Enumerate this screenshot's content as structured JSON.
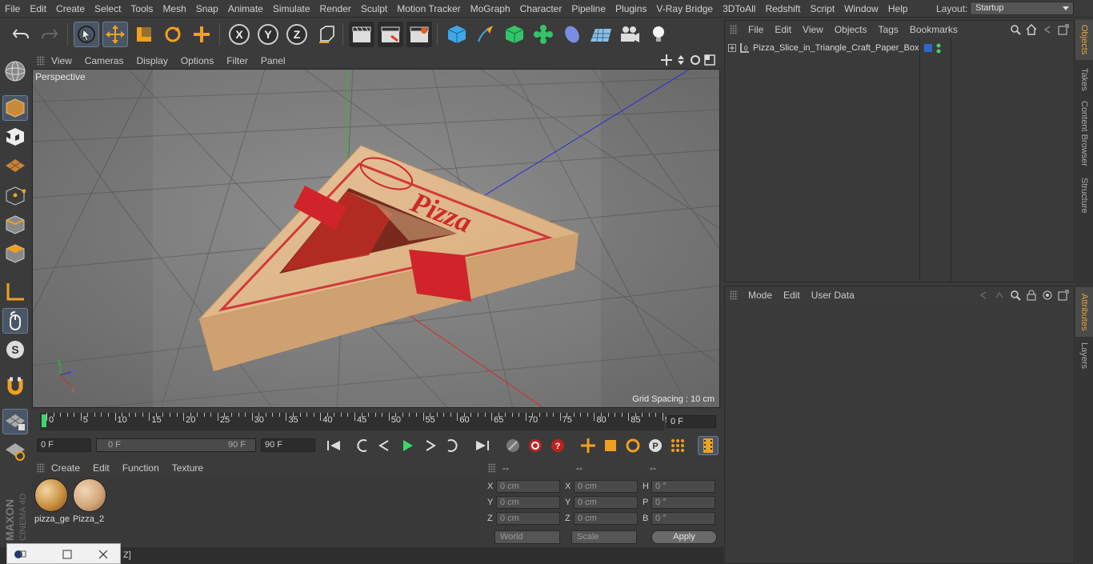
{
  "menubar": {
    "items": [
      "File",
      "Edit",
      "Create",
      "Select",
      "Tools",
      "Mesh",
      "Snap",
      "Animate",
      "Simulate",
      "Render",
      "Sculpt",
      "Motion Tracker",
      "MoGraph",
      "Character",
      "Pipeline",
      "Plugins",
      "V-Ray Bridge",
      "3DToAll",
      "Redshift",
      "Script",
      "Window",
      "Help"
    ],
    "layout_label": "Layout:",
    "layout_value": "Startup"
  },
  "toolbar": {
    "x_label": "X",
    "y_label": "Y",
    "z_label": "Z"
  },
  "viewport": {
    "menu": [
      "View",
      "Cameras",
      "Display",
      "Options",
      "Filter",
      "Panel"
    ],
    "label": "Perspective",
    "grid_spacing": "Grid Spacing : 10 cm",
    "box_text": "Pizza"
  },
  "timeline": {
    "ticks": [
      "0",
      "5",
      "10",
      "15",
      "20",
      "25",
      "30",
      "35",
      "40",
      "45",
      "50",
      "55",
      "60",
      "65",
      "70",
      "75",
      "80",
      "85",
      "90"
    ],
    "current_frame": "0 F"
  },
  "transport": {
    "start": "0 F",
    "range_start": "0 F",
    "range_end": "90 F",
    "end": "90 F"
  },
  "materials": {
    "menu": [
      "Create",
      "Edit",
      "Function",
      "Texture"
    ],
    "items": [
      {
        "name": "pizza_ge"
      },
      {
        "name": "Pizza_2"
      }
    ]
  },
  "coordinates": {
    "head": [
      "--",
      "--",
      "--"
    ],
    "rows": [
      {
        "l1": "X",
        "v1": "0 cm",
        "l2": "X",
        "v2": "0 cm",
        "l3": "H",
        "v3": "0 °"
      },
      {
        "l1": "Y",
        "v1": "0 cm",
        "l2": "Y",
        "v2": "0 cm",
        "l3": "P",
        "v3": "0 °"
      },
      {
        "l1": "Z",
        "v1": "0 cm",
        "l2": "Z",
        "v2": "0 cm",
        "l3": "B",
        "v3": "0 °"
      }
    ],
    "world": "World",
    "scale": "Scale",
    "apply": "Apply"
  },
  "objects": {
    "menu": [
      "File",
      "Edit",
      "View",
      "Objects",
      "Tags",
      "Bookmarks"
    ],
    "item_name": "Pizza_Slice_in_Triangle_Craft_Paper_Box"
  },
  "attributes": {
    "menu": [
      "Mode",
      "Edit",
      "User Data"
    ]
  },
  "side_tabs": [
    "Objects",
    "Takes",
    "Content Browser",
    "Structure",
    "Attributes",
    "Layers"
  ],
  "status": {
    "text": "Z]"
  },
  "brand": {
    "line1": "MAXON",
    "line2": "CINEMA 4D"
  },
  "colors": {
    "accent": "#e8a33a",
    "highlight": "#4a5665",
    "panel": "#3a3a3a"
  }
}
